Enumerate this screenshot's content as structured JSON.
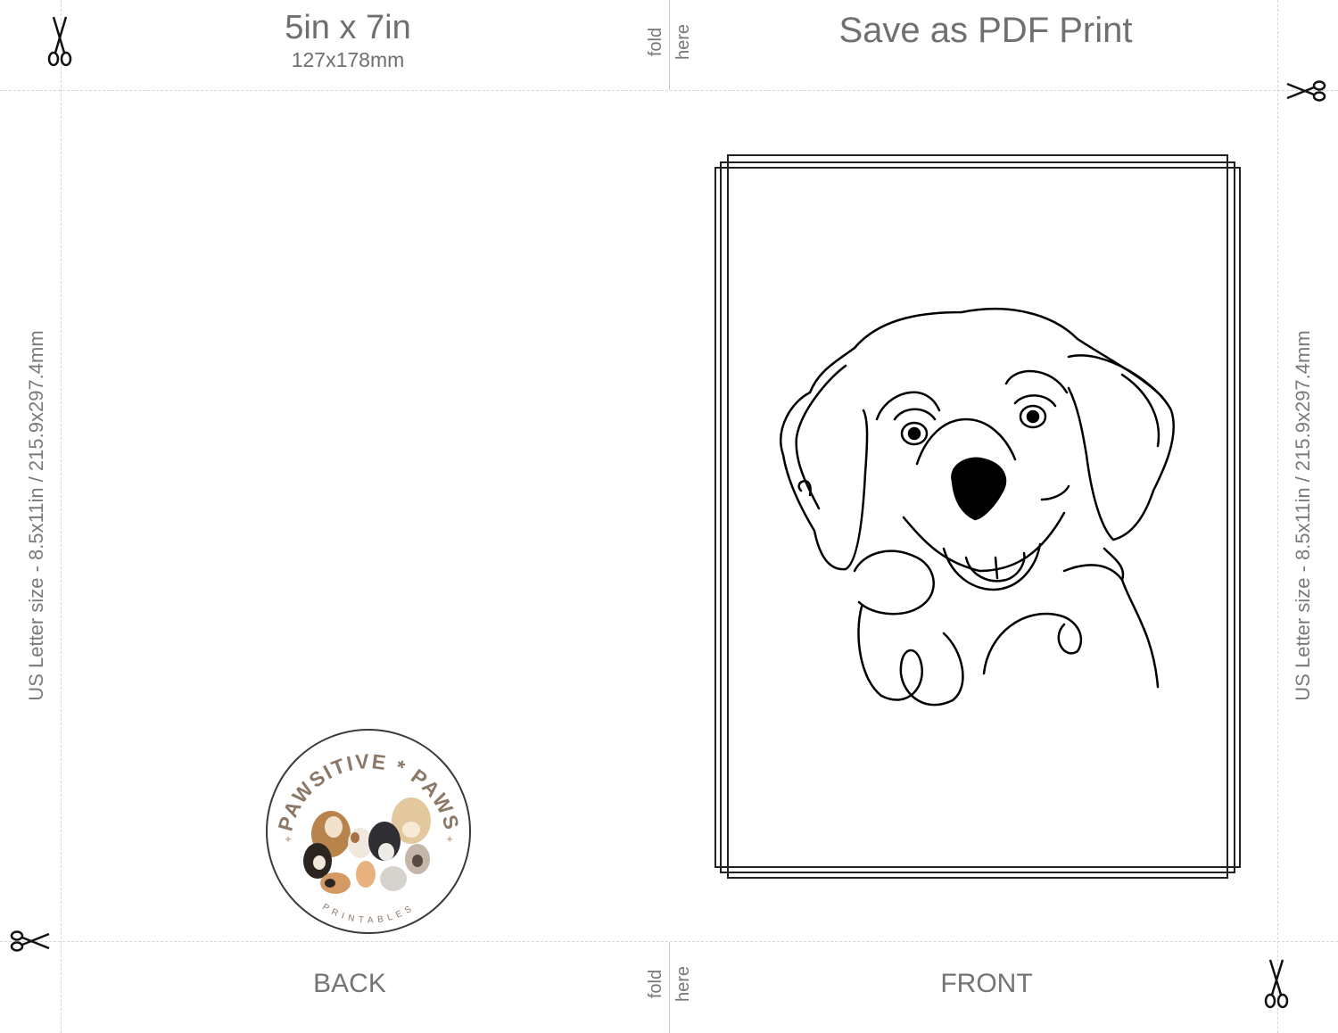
{
  "header": {
    "size_title": "5in x 7in",
    "size_metric": "127x178mm",
    "save_label": "Save as PDF Print"
  },
  "fold": {
    "word1": "fold",
    "word2": "here"
  },
  "side_label": "US Letter size - 8.5x11in / 215.9x297.4mm",
  "panels": {
    "back": "BACK",
    "front": "FRONT"
  },
  "logo": {
    "title": "PAWSITIVE * PAWS",
    "subtitle": "PRINTABLES"
  },
  "icons": {
    "cut_marks": "scissors-icon",
    "front_art": "dog-line-drawing-icon"
  },
  "colors": {
    "text": "#707070",
    "guides": "#d6d6d6",
    "logo_text": "#8b7866",
    "line_art": "#000000"
  }
}
